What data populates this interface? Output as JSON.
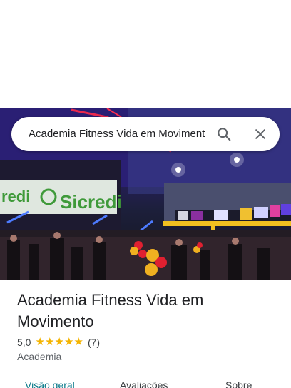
{
  "search": {
    "query": "Academia Fitness Vida em Movimento",
    "search_icon": "search-icon",
    "close_icon": "close-icon"
  },
  "hero": {
    "banner_text": "Sicredi",
    "banner_text_left": "redi",
    "image_description_icon": "gym-photo"
  },
  "place": {
    "title": "Academia Fitness Vida em Movimento",
    "rating_value": "5,0",
    "rating_stars": 5,
    "review_count": "(7)",
    "category": "Academia"
  },
  "tabs": [
    {
      "label": "Visão geral",
      "active": true
    },
    {
      "label": "Avaliações",
      "active": false
    },
    {
      "label": "Sobre",
      "active": false
    }
  ],
  "colors": {
    "accent": "#0b7a8a",
    "star": "#f4b400",
    "text": "#202124",
    "secondary_text": "#5f6368"
  }
}
